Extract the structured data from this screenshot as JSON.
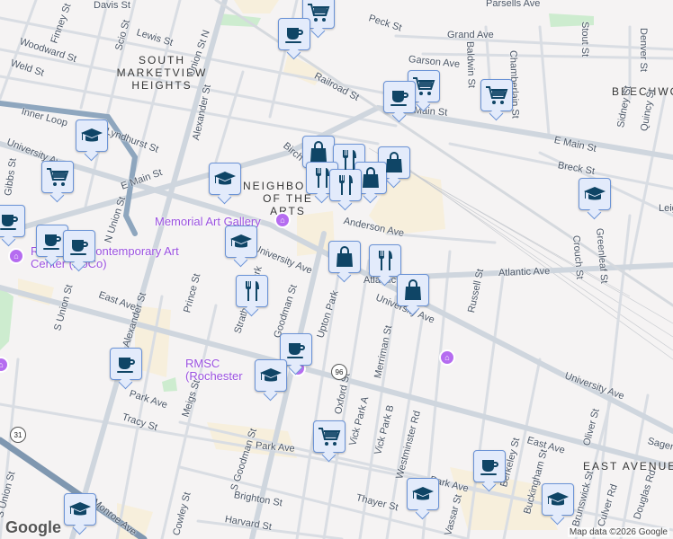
{
  "map": {
    "neighborhoods": [
      "SOUTH MARKETVIEW HEIGHTS",
      "NEIGHBORHOOD OF THE ARTS",
      "BEECHWOOD",
      "EAST AVENUE"
    ],
    "streets": {
      "davis": "Davis St",
      "lewis": "Lewis St",
      "finney": "Finney St",
      "scio": "Scio St",
      "woodward": "Woodward St",
      "weld": "Weld St",
      "union_n": "Union St N",
      "railroad": "Railroad St",
      "peck": "Peck St",
      "parsells": "Parsells Ave",
      "grand": "Grand Ave",
      "garson": "Garson Ave",
      "baldwin": "Baldwin St",
      "chamberlain": "Chamberlain St",
      "stout": "Stout St",
      "denver": "Denver St",
      "main_e": "E Main St",
      "main_w": "E Main St",
      "main_mid": "Main St",
      "inner_loop": "Inner Loop",
      "lyndhurst": "Lyndhurst St",
      "university_w": "University Ave",
      "alexander": "Alexander St",
      "birch": "Birch",
      "gibbs": "Gibbs St",
      "n_union": "N Union St",
      "breck": "Breck St",
      "sidney": "Sidney St",
      "quincy": "Quincy St",
      "anderson": "Anderson Ave",
      "leigh": "Leigh",
      "crouch": "Crouch St",
      "greenleaf": "Greenleaf St",
      "university_mid": "University Ave",
      "atlantic": "Atlantic Ave",
      "atlantic2": "Atlantic",
      "university_e": "University Ave",
      "russell": "Russell St",
      "east_ave_w": "East Ave",
      "s_union": "S Union St",
      "s_union2": "S Union St",
      "prince": "Prince St",
      "strathallan": "Strathallan Park",
      "goodman": "Goodman St",
      "upton": "Upton Park",
      "alexander_s": "Alexander St",
      "park_w": "Park Ave",
      "tracy": "Tracy St",
      "meigs": "Meigs St",
      "s_goodman": "S Goodman St",
      "park_e": "Park Ave",
      "oxford": "Oxford St",
      "vick_a": "Vick Park A",
      "vick_b": "Vick Park B",
      "merriman": "Merriman St",
      "westminster": "Westminster Rd",
      "east_ave_e": "East Ave",
      "oliver": "Oliver St",
      "sager": "Sager",
      "berkeley": "Berkeley St",
      "buckingham": "Buckingham St",
      "culver": "Culver Rd",
      "douglas": "Douglas Rd",
      "brunswick": "Brunswick St",
      "vassar": "Vassar St",
      "thayer": "Thayer St",
      "brighton": "Brighton St",
      "harvard": "Harvard St",
      "cowley": "Cowley St",
      "monroe": "Monroe Ave",
      "park_small": "Park Ave"
    },
    "pois": {
      "memorial": "Memorial Art Gallery",
      "roco": "Rochester Contemporary Art Center (RoCo)",
      "rmsc": "RMSC (Rochester Museum & Science Center)"
    },
    "shields": [
      "96",
      "31"
    ],
    "credit": "Map data ©2026 Google",
    "logo": "Google",
    "colors": {
      "marker_fill": "#e3ebfb",
      "marker_border": "#6b93d6",
      "icon": "#0f4566",
      "poi": "#9b51e0"
    }
  }
}
